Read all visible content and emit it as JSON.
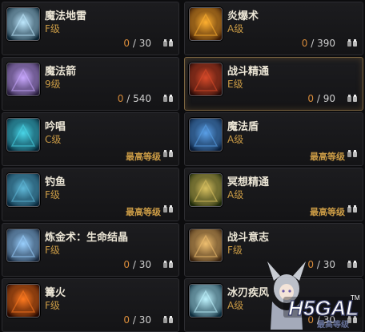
{
  "skills": [
    {
      "name": "魔法地雷",
      "grade": "F级",
      "current": "0",
      "max": "30",
      "icon": "magic-mine-icon",
      "colors": [
        "#0b2433",
        "#bfe9ff"
      ]
    },
    {
      "name": "炎爆术",
      "grade": "A级",
      "current": "0",
      "max": "390",
      "icon": "pyroblast-icon",
      "colors": [
        "#3a1a05",
        "#ffb030"
      ]
    },
    {
      "name": "魔法箭",
      "grade": "9级",
      "current": "0",
      "max": "540",
      "icon": "magic-arrow-icon",
      "colors": [
        "#2a1f3e",
        "#c9a8ff"
      ]
    },
    {
      "name": "战斗精通",
      "grade": "E级",
      "current": "0",
      "max": "90",
      "icon": "combat-mastery-icon",
      "colors": [
        "#2a0c08",
        "#d84a2a"
      ],
      "selected": true
    },
    {
      "name": "吟唱",
      "grade": "C级",
      "maxed": "最高等级",
      "icon": "chant-icon",
      "colors": [
        "#062a3a",
        "#49d6e8"
      ]
    },
    {
      "name": "魔法盾",
      "grade": "A级",
      "maxed": "最高等级",
      "icon": "magic-shield-icon",
      "colors": [
        "#0a1e3a",
        "#5aa0e8"
      ]
    },
    {
      "name": "钓鱼",
      "grade": "F级",
      "maxed": "最高等级",
      "icon": "fishing-icon",
      "colors": [
        "#0a2a3e",
        "#5fb8d8"
      ]
    },
    {
      "name": "冥想精通",
      "grade": "A级",
      "maxed": "最高等级",
      "icon": "meditation-icon",
      "colors": [
        "#1e2a0a",
        "#d8c060"
      ]
    },
    {
      "name": "炼金术：生命结晶",
      "grade": "F级",
      "current": "0",
      "max": "30",
      "icon": "alchemy-crystal-icon",
      "colors": [
        "#1a2a3e",
        "#9ad0ff"
      ]
    },
    {
      "name": "战斗意志",
      "grade": "F级",
      "current": "0",
      "max": "30",
      "icon": "combat-will-icon",
      "colors": [
        "#3a2410",
        "#f0c070"
      ]
    },
    {
      "name": "篝火",
      "grade": "F级",
      "current": "0",
      "max": "30",
      "icon": "campfire-icon",
      "colors": [
        "#2a0a00",
        "#ff7a20"
      ]
    },
    {
      "name": "冰刃疾风",
      "grade": "A级",
      "current": "0",
      "max": "30",
      "icon": "ice-blade-icon",
      "colors": [
        "#0e2e3e",
        "#bff4ff"
      ]
    }
  ],
  "watermark": {
    "logo": "H5GAL",
    "tm": "TM",
    "sub": "最高等级"
  }
}
